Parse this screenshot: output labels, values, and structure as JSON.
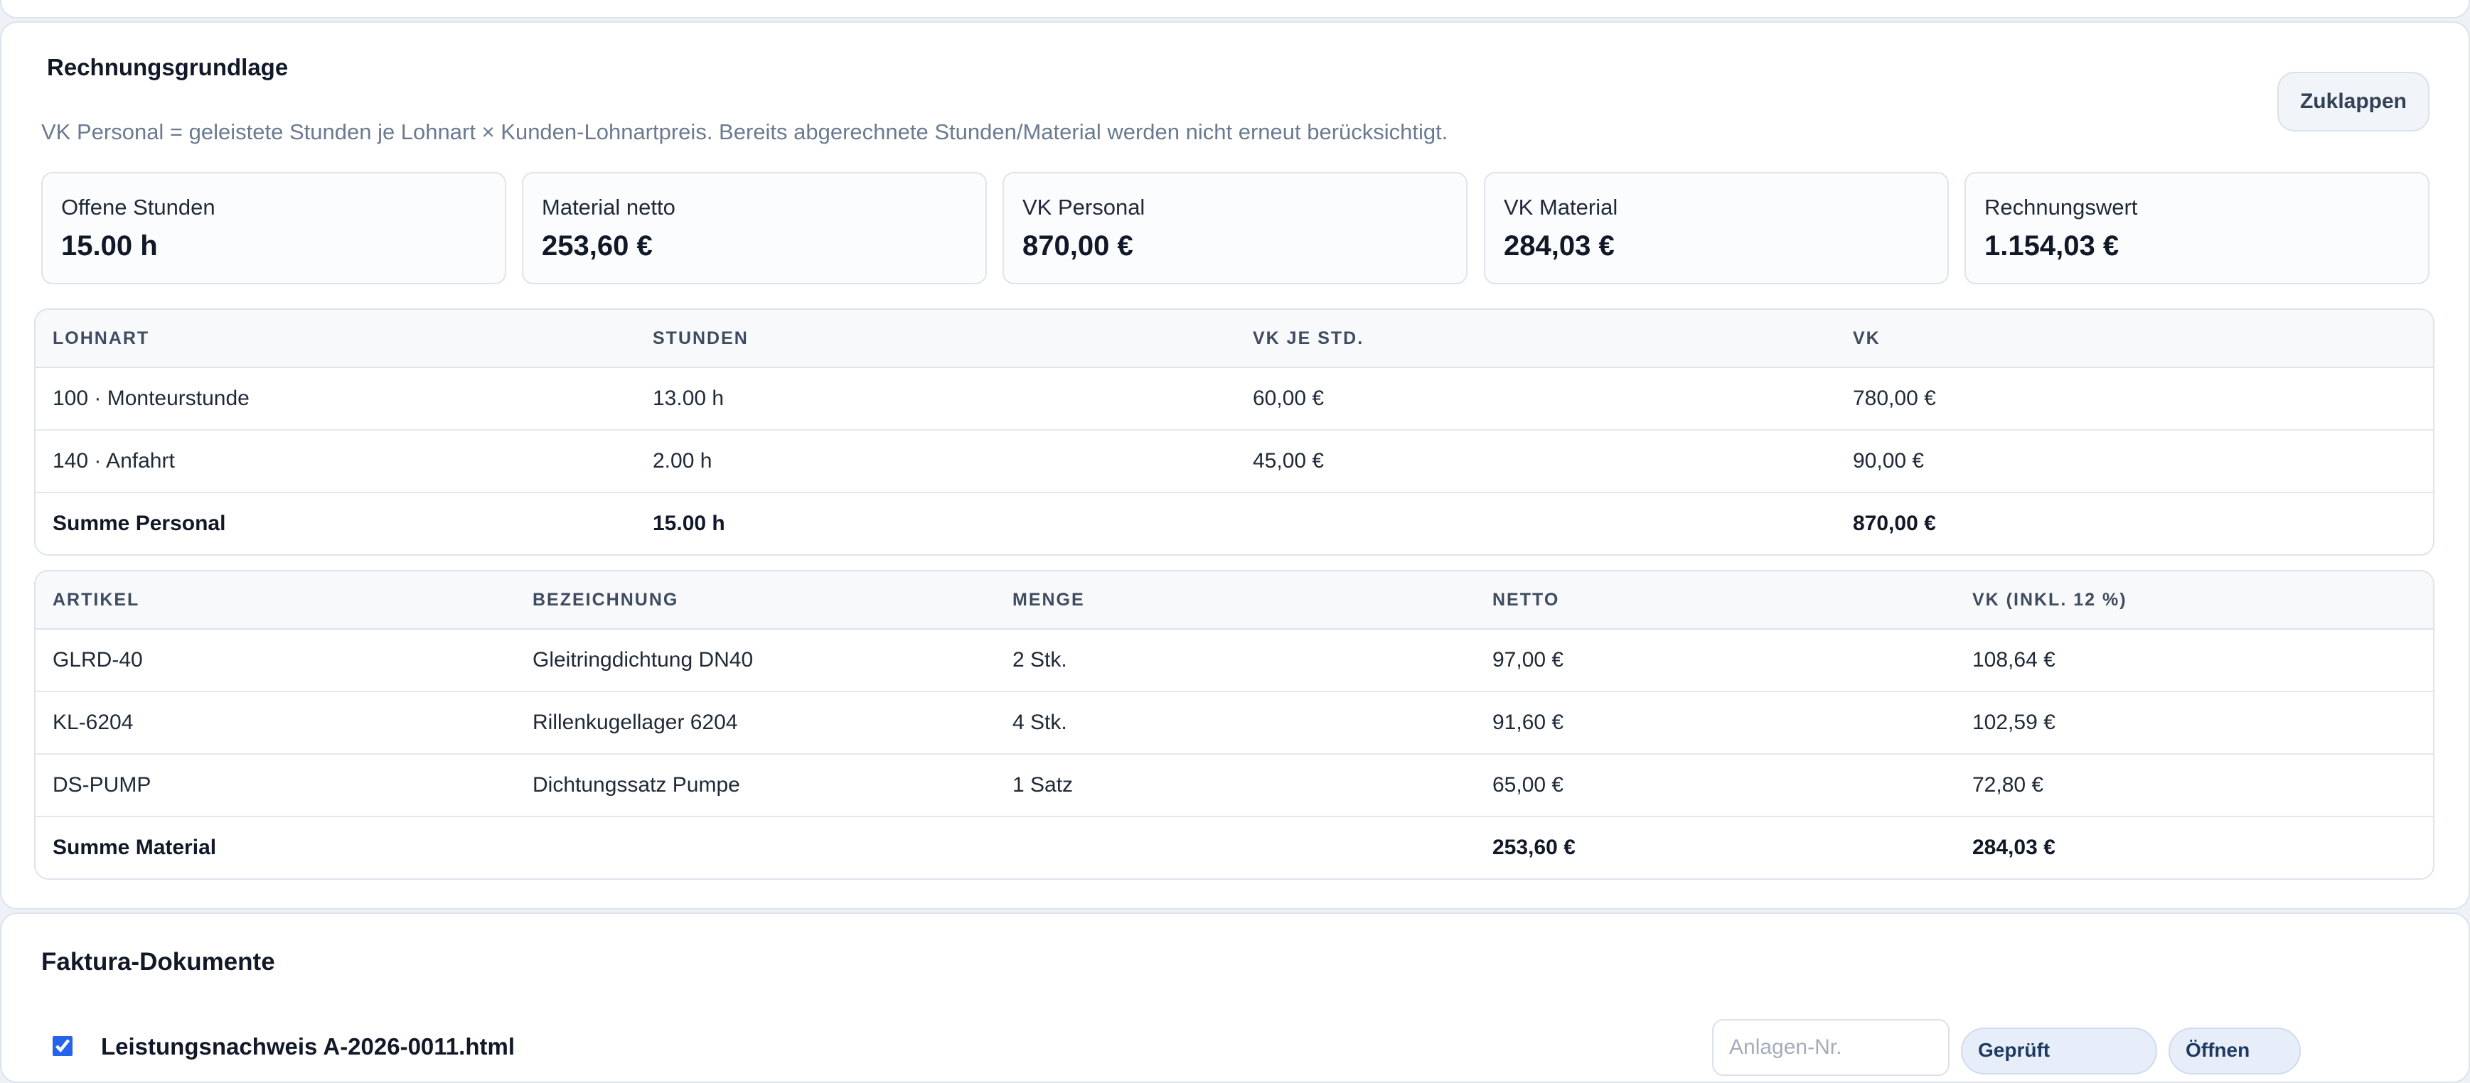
{
  "section": {
    "title": "Rechnungsgrundlage",
    "collapse_label": "Zuklappen",
    "hint": "VK Personal = geleistete Stunden je Lohnart × Kunden-Lohnartpreis. Bereits abgerechnete Stunden/Material werden nicht erneut berücksichtigt."
  },
  "stats": [
    {
      "label": "Offene Stunden",
      "value": "15.00 h"
    },
    {
      "label": "Material netto",
      "value": "253,60 €"
    },
    {
      "label": "VK Personal",
      "value": "870,00 €"
    },
    {
      "label": "VK Material",
      "value": "284,03 €"
    },
    {
      "label": "Rechnungswert",
      "value": "1.154,03 €"
    }
  ],
  "labor": {
    "headers": [
      "LOHNART",
      "STUNDEN",
      "VK JE STD.",
      "VK"
    ],
    "rows": [
      [
        "100 · Monteurstunde",
        "13.00 h",
        "60,00 €",
        "780,00 €"
      ],
      [
        "140 · Anfahrt",
        "2.00 h",
        "45,00 €",
        "90,00 €"
      ]
    ],
    "total": {
      "label": "Summe Personal",
      "hours": "15.00 h",
      "vk": "870,00 €"
    }
  },
  "material": {
    "headers": [
      "ARTIKEL",
      "BEZEICHNUNG",
      "MENGE",
      "NETTO",
      "VK (INKL. 12 %)"
    ],
    "rows": [
      [
        "GLRD-40",
        "Gleitringdichtung DN40",
        "2 Stk.",
        "97,00 €",
        "108,64 €"
      ],
      [
        "KL-6204",
        "Rillenkugellager 6204",
        "4 Stk.",
        "91,60 €",
        "102,59 €"
      ],
      [
        "DS-PUMP",
        "Dichtungssatz Pumpe",
        "1 Satz",
        "65,00 €",
        "72,80 €"
      ]
    ],
    "total": {
      "label": "Summe Material",
      "netto": "253,60 €",
      "vk": "284,03 €"
    }
  },
  "faktura": {
    "title": "Faktura-Dokumente",
    "document": {
      "name": "Leistungsnachweis A-2026-0011.html",
      "checked": true,
      "anlage_placeholder": "Anlagen-Nr.",
      "status_label": "Geprüft",
      "open_label": "Öffnen"
    }
  },
  "colors": {
    "page_bg": "#eef2f7",
    "card_bg": "#ffffff",
    "border": "#dde3ec",
    "accent": "#2563eb",
    "muted_text": "#6b7a90"
  }
}
